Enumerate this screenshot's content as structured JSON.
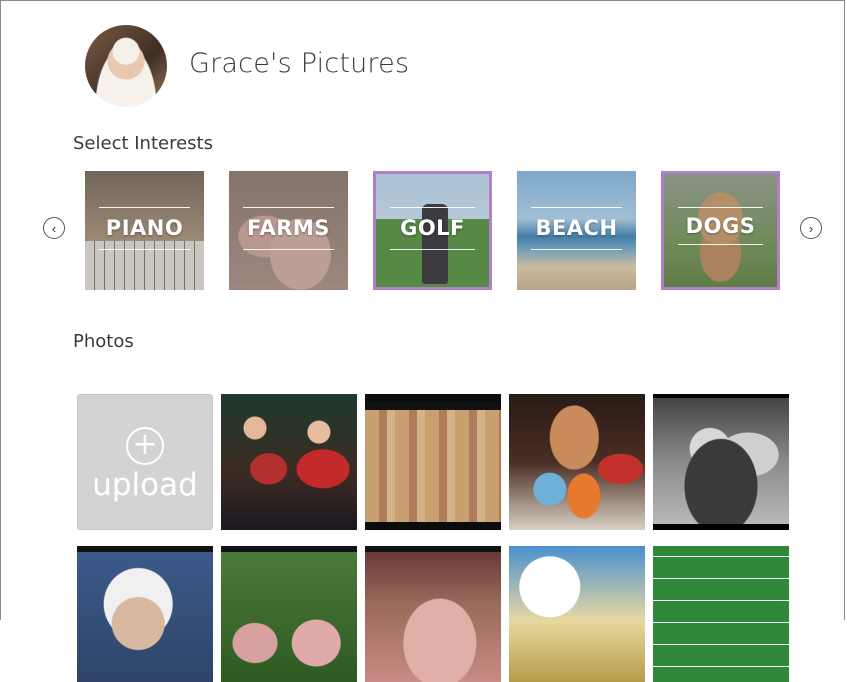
{
  "profile": {
    "name": "Grace's Pictures",
    "avatar": "user-avatar"
  },
  "interests": {
    "title": "Select Interests",
    "prev_icon": "chevron-left-icon",
    "next_icon": "chevron-right-icon",
    "items": [
      {
        "label": "PIANO",
        "selected": false
      },
      {
        "label": "FARMS",
        "selected": false
      },
      {
        "label": "GOLF",
        "selected": true
      },
      {
        "label": "BEACH",
        "selected": false
      },
      {
        "label": "DOGS",
        "selected": true
      }
    ],
    "selected_color": "#b37fc6"
  },
  "photos": {
    "title": "Photos",
    "upload_label": "upload",
    "upload_icon": "plus-circle-icon"
  }
}
